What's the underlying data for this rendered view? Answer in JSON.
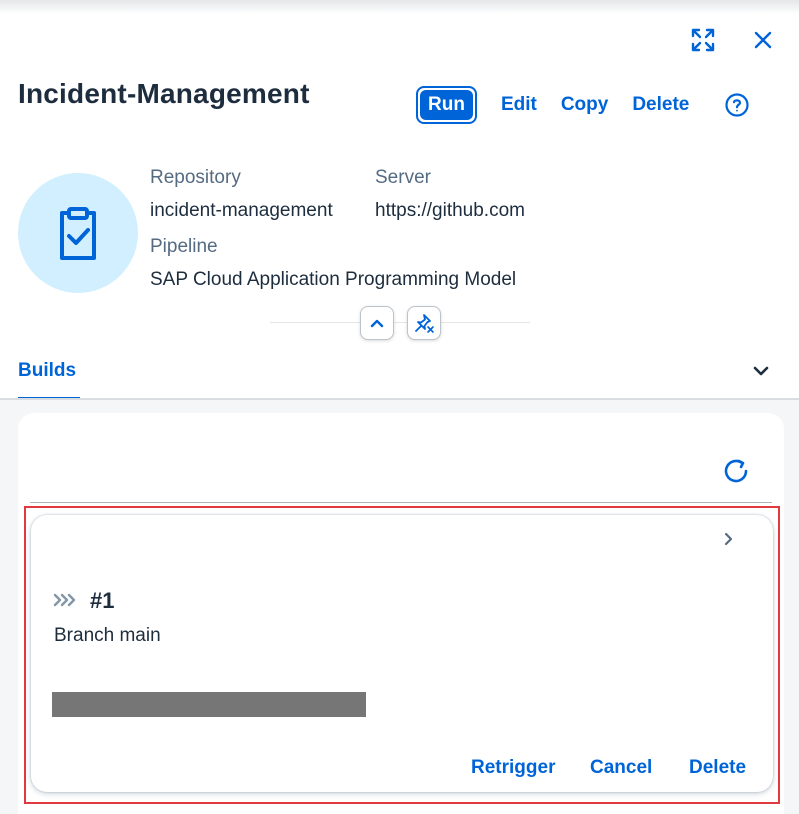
{
  "header": {
    "title": "Incident-Management",
    "actions": {
      "run": "Run",
      "edit": "Edit",
      "copy": "Copy",
      "delete": "Delete"
    },
    "icons": [
      "expand-icon",
      "close-icon",
      "help-icon"
    ]
  },
  "details": {
    "avatar_icon": "clipboard-check-icon",
    "repository_label": "Repository",
    "repository_value": "incident-management",
    "server_label": "Server",
    "server_value": "https://github.com",
    "pipeline_label": "Pipeline",
    "pipeline_value": "SAP Cloud Application Programming Model"
  },
  "tabs": {
    "builds": "Builds"
  },
  "build_card": {
    "number": "#1",
    "branch": "Branch main",
    "actions": {
      "retrigger": "Retrigger",
      "cancel": "Cancel",
      "delete": "Delete"
    }
  },
  "colors": {
    "accent": "#0064d9",
    "title": "#1d2d3e",
    "label": "#556b82",
    "avatar_bg": "#d1efff",
    "highlight": "#e0393e",
    "redacted": "#767676"
  }
}
